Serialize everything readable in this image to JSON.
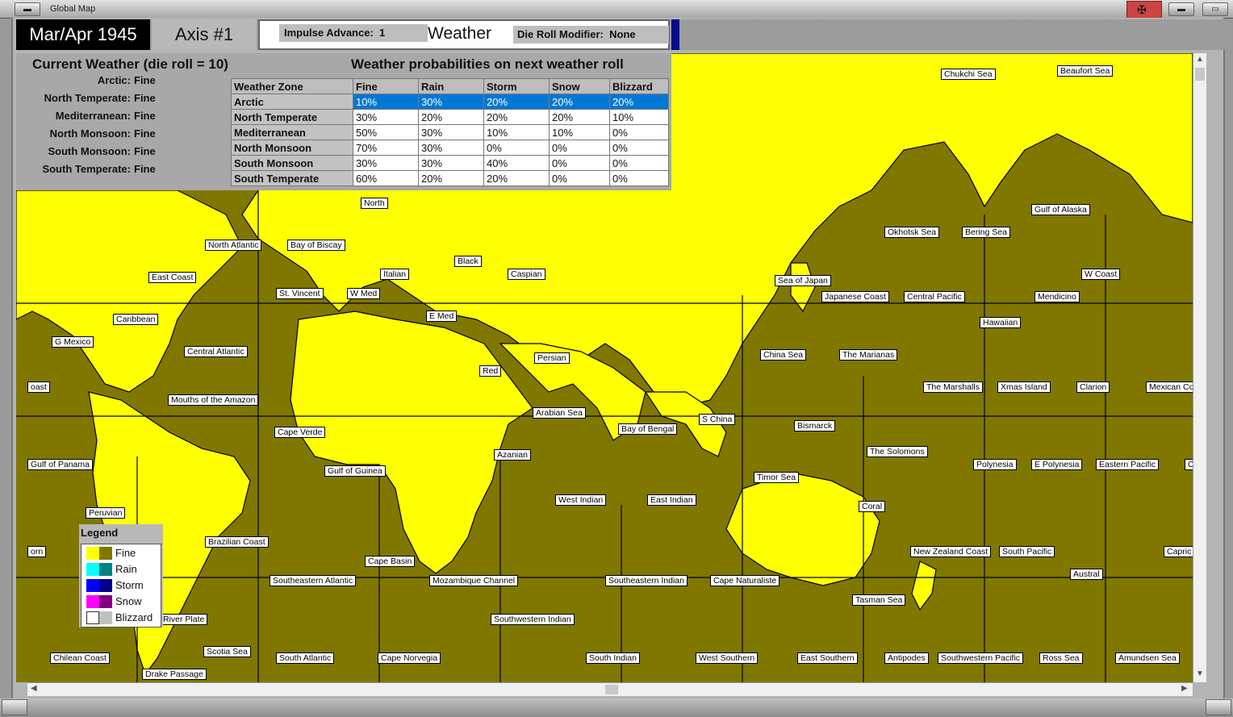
{
  "window": {
    "title": "Global Map"
  },
  "header": {
    "date": "Mar/Apr 1945",
    "side": "Axis #1",
    "impulse_label": "Impulse Advance:",
    "impulse_value": "1",
    "mode": "Weather",
    "die_roll_label": "Die Roll Modifier:",
    "die_roll_value": "None"
  },
  "current_weather": {
    "title": "Current Weather (die roll = 10)",
    "zones": [
      {
        "zone": "Arctic:",
        "weather": "Fine"
      },
      {
        "zone": "North Temperate:",
        "weather": "Fine"
      },
      {
        "zone": "Mediterranean:",
        "weather": "Fine"
      },
      {
        "zone": "North Monsoon:",
        "weather": "Fine"
      },
      {
        "zone": "South Monsoon:",
        "weather": "Fine"
      },
      {
        "zone": "South Temperate:",
        "weather": "Fine"
      }
    ]
  },
  "probabilities": {
    "title": "Weather probabilities on next weather roll",
    "headers": [
      "Weather Zone",
      "Fine",
      "Rain",
      "Storm",
      "Snow",
      "Blizzard"
    ],
    "rows": [
      [
        "Arctic",
        "10%",
        "30%",
        "20%",
        "20%",
        "20%"
      ],
      [
        "North Temperate",
        "30%",
        "20%",
        "20%",
        "20%",
        "10%"
      ],
      [
        "Mediterranean",
        "50%",
        "30%",
        "10%",
        "10%",
        "0%"
      ],
      [
        "North Monsoon",
        "70%",
        "30%",
        "0%",
        "0%",
        "0%"
      ],
      [
        "South Monsoon",
        "30%",
        "30%",
        "40%",
        "0%",
        "0%"
      ],
      [
        "South Temperate",
        "60%",
        "20%",
        "20%",
        "0%",
        "0%"
      ]
    ],
    "selected_row": 0
  },
  "legend": {
    "title": "Legend",
    "items": [
      {
        "label": "Fine",
        "land": "#ffff00",
        "sea": "#7f7700"
      },
      {
        "label": "Rain",
        "land": "#00ffff",
        "sea": "#008080"
      },
      {
        "label": "Storm",
        "land": "#0000ff",
        "sea": "#00008b"
      },
      {
        "label": "Snow",
        "land": "#ff00ff",
        "sea": "#800080"
      },
      {
        "label": "Blizzard",
        "land": "#ffffff",
        "sea": "#c0c0c0"
      }
    ]
  },
  "colors": {
    "fine_land": "#ffff00",
    "fine_sea": "#7f7700",
    "selected_row": "#0078d7"
  },
  "map_labels": [
    "Chukchi Sea",
    "Beaufort Sea",
    "Gulf of Alaska",
    "Okhotsk Sea",
    "Bering Sea",
    "North",
    "North Atlantic",
    "Bay of Biscay",
    "Black",
    "Caspian",
    "East Coast",
    "Italian",
    "St. Vincent",
    "W Med",
    "Sea of Japan",
    "W Coast",
    "Japanese Coast",
    "Central Pacific",
    "Mendicino",
    "E Med",
    "Caribbean",
    "Hawaiian",
    "G Mexico",
    "Central Atlantic",
    "China Sea",
    "The Marianas",
    "Persian",
    "Red",
    "oast",
    "The Marshalls",
    "Xmas Island",
    "Clarion",
    "Mexican Co",
    "Mouths of the Amazon",
    "Arabian Sea",
    "S China",
    "Bismarck",
    "Cape Verde",
    "Bay of Bengal",
    "The Solomons",
    "Azanian",
    "Gulf of Panama",
    "Gulf of Guinea",
    "Polynesia",
    "E Polynesia",
    "Eastern Pacific",
    "C",
    "Timor Sea",
    "West Indian",
    "East Indian",
    "Peruvian",
    "Coral",
    "Brazilian Coast",
    "orn",
    "New Zealand Coast",
    "South Pacific",
    "Capric",
    "Cape Basin",
    "Austral",
    "Southeastern Atlantic",
    "Mozambique Channel",
    "Southeastern Indian",
    "Cape Naturaliste",
    "Tasman Sea",
    "River Plate",
    "Southwestern Indian",
    "Scotia Sea",
    "Chilean Coast",
    "South Atlantic",
    "Cape Norvegia",
    "South Indian",
    "West Southern",
    "East Southern",
    "Antipodes",
    "Southwestern Pacific",
    "Ross Sea",
    "Amundsen Sea",
    "Drake Passage"
  ]
}
